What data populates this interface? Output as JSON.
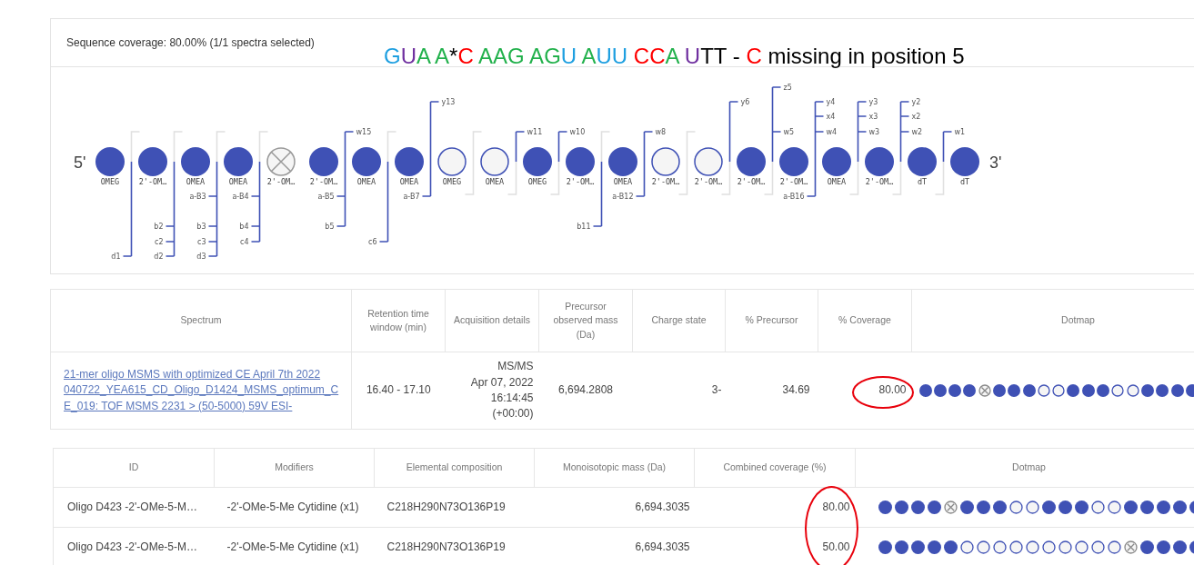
{
  "sequence_panel": {
    "title": "Sequence coverage: 80.00% (1/1 spectra selected)",
    "annotation": [
      {
        "text": "G",
        "color": "#1e9fe0"
      },
      {
        "text": "U",
        "color": "#7030a0"
      },
      {
        "text": "A A",
        "color": "#22b14c"
      },
      {
        "text": "*",
        "color": "#000000"
      },
      {
        "text": "C",
        "color": "#ff0000"
      },
      {
        "text": " AAG AG",
        "color": "#22b14c"
      },
      {
        "text": "U",
        "color": "#1e9fe0"
      },
      {
        "text": " A",
        "color": "#22b14c"
      },
      {
        "text": "UU",
        "color": "#1e9fe0"
      },
      {
        "text": " CC",
        "color": "#ff0000"
      },
      {
        "text": "A",
        "color": "#22b14c"
      },
      {
        "text": " U",
        "color": "#7030a0"
      },
      {
        "text": "TT - ",
        "color": "#000000"
      },
      {
        "text": "C",
        "color": "#ff0000"
      },
      {
        "text": " missing in position 5",
        "color": "#000000"
      }
    ],
    "five_prime": "5'",
    "three_prime": "3'",
    "nucleotides": [
      {
        "label": "OMEG",
        "kind": "filled"
      },
      {
        "label": "2'-OM…",
        "kind": "filled"
      },
      {
        "label": "OMEA",
        "kind": "filled"
      },
      {
        "label": "OMEA",
        "kind": "filled"
      },
      {
        "label": "2'-OM…",
        "kind": "missing"
      },
      {
        "label": "2'-OM…",
        "kind": "filled"
      },
      {
        "label": "OMEA",
        "kind": "filled"
      },
      {
        "label": "OMEA",
        "kind": "filled"
      },
      {
        "label": "OMEG",
        "kind": "empty"
      },
      {
        "label": "OMEA",
        "kind": "empty"
      },
      {
        "label": "OMEG",
        "kind": "filled"
      },
      {
        "label": "2'-OM…",
        "kind": "filled"
      },
      {
        "label": "OMEA",
        "kind": "filled"
      },
      {
        "label": "2'-OM…",
        "kind": "empty"
      },
      {
        "label": "2'-OM…",
        "kind": "empty"
      },
      {
        "label": "2'-OM…",
        "kind": "filled"
      },
      {
        "label": "2'-OM…",
        "kind": "filled"
      },
      {
        "label": "OMEA",
        "kind": "filled"
      },
      {
        "label": "2'-OM…",
        "kind": "filled"
      },
      {
        "label": "dT",
        "kind": "filled"
      },
      {
        "label": "dT",
        "kind": "filled"
      }
    ],
    "gaps": [
      {
        "kind": "fragments",
        "below": {
          "d": "d1"
        }
      },
      {
        "kind": "fragments",
        "below": {
          "b": "b2",
          "c": "c2",
          "d": "d2"
        }
      },
      {
        "kind": "fragments",
        "below": {
          "a_b": "a-B3",
          "b": "b3",
          "c": "c3",
          "d": "d3"
        }
      },
      {
        "kind": "fragments",
        "below": {
          "a_b": "a-B4",
          "b": "b4",
          "c": "c4"
        }
      },
      {
        "kind": "blank"
      },
      {
        "kind": "fragments",
        "above": {
          "w": "w15"
        },
        "below": {
          "a_b": "a-B5",
          "b": "b5"
        }
      },
      {
        "kind": "fragments",
        "below": {
          "c": "c6"
        }
      },
      {
        "kind": "fragments",
        "above": {
          "y": "y13"
        },
        "below": {
          "a_b": "a-B7"
        }
      },
      {
        "kind": "fragments"
      },
      {
        "kind": "fragments",
        "above": {
          "w": "w11"
        }
      },
      {
        "kind": "fragments",
        "above": {
          "w": "w10"
        }
      },
      {
        "kind": "fragments",
        "below": {
          "b": "b11"
        }
      },
      {
        "kind": "fragments",
        "above": {
          "w": "w8"
        },
        "below": {
          "a_b": "a-B12"
        }
      },
      {
        "kind": "fragments"
      },
      {
        "kind": "fragments",
        "above": {
          "y": "y6"
        }
      },
      {
        "kind": "fragments",
        "above": {
          "z": "z5",
          "w": "w5"
        }
      },
      {
        "kind": "fragments",
        "above": {
          "y": "y4",
          "x": "x4",
          "w": "w4"
        },
        "below": {
          "a_b": "a-B16"
        }
      },
      {
        "kind": "fragments",
        "above": {
          "y": "y3",
          "x": "x3",
          "w": "w3"
        }
      },
      {
        "kind": "fragments",
        "above": {
          "y": "y2",
          "x": "x2",
          "w": "w2"
        }
      },
      {
        "kind": "fragments",
        "above": {
          "w": "w1"
        }
      }
    ]
  },
  "spectra_table": {
    "columns": [
      "Spectrum",
      "Retention time window (min)",
      "Acquisition details",
      "Precursor observed mass (Da)",
      "Charge state",
      "% Precursor",
      "% Coverage",
      "Dotmap"
    ],
    "rows": [
      {
        "spectrum": "21-mer oligo MSMS with optimized CE April 7th 2022 040722_YEA615_CD_Oligo_D1424_MSMS_optimum_CE_019: TOF MSMS 2231 > (50-5000) 59V ESI-",
        "retention": "16.40 - 17.10",
        "acquisition": [
          "MS/MS",
          "Apr 07, 2022",
          "16:14:45",
          "(+00:00)"
        ],
        "precursor_mass": "6,694.2808",
        "charge": "3-",
        "precursor_pct": "34.69",
        "coverage": "80.00",
        "coverage_circled": true,
        "dots": [
          {
            "kind": "filled"
          },
          {
            "kind": "filled"
          },
          {
            "kind": "filled"
          },
          {
            "kind": "filled"
          },
          {
            "kind": "missing"
          },
          {
            "kind": "filled"
          },
          {
            "kind": "filled"
          },
          {
            "kind": "filled"
          },
          {
            "kind": "empty"
          },
          {
            "kind": "empty"
          },
          {
            "kind": "filled"
          },
          {
            "kind": "filled"
          },
          {
            "kind": "filled"
          },
          {
            "kind": "empty"
          },
          {
            "kind": "empty"
          },
          {
            "kind": "filled"
          },
          {
            "kind": "filled"
          },
          {
            "kind": "filled"
          },
          {
            "kind": "filled"
          }
        ]
      }
    ]
  },
  "oligo_table": {
    "columns": [
      "ID",
      "Modifiers",
      "Elemental composition",
      "Monoisotopic mass (Da)",
      "Combined coverage (%)",
      "Dotmap"
    ],
    "coverage_circled": true,
    "rows": [
      {
        "id": "Oligo D423 -2'-OMe-5-M…",
        "modifiers": "-2'-OMe-5-Me Cytidine (x1)",
        "composition": "C218H290N73O136P19",
        "mass": "6,694.3035",
        "coverage": "80.00",
        "dots": [
          {
            "kind": "filled"
          },
          {
            "kind": "filled"
          },
          {
            "kind": "filled"
          },
          {
            "kind": "filled"
          },
          {
            "kind": "missing"
          },
          {
            "kind": "filled"
          },
          {
            "kind": "filled"
          },
          {
            "kind": "filled"
          },
          {
            "kind": "empty"
          },
          {
            "kind": "empty"
          },
          {
            "kind": "filled"
          },
          {
            "kind": "filled"
          },
          {
            "kind": "filled"
          },
          {
            "kind": "empty"
          },
          {
            "kind": "empty"
          },
          {
            "kind": "filled"
          },
          {
            "kind": "filled"
          },
          {
            "kind": "filled"
          },
          {
            "kind": "filled"
          },
          {
            "kind": "filled"
          }
        ]
      },
      {
        "id": "Oligo D423 -2'-OMe-5-M…",
        "modifiers": "-2'-OMe-5-Me Cytidine (x1)",
        "composition": "C218H290N73O136P19",
        "mass": "6,694.3035",
        "coverage": "50.00",
        "dots": [
          {
            "kind": "filled"
          },
          {
            "kind": "filled"
          },
          {
            "kind": "filled"
          },
          {
            "kind": "filled"
          },
          {
            "kind": "filled"
          },
          {
            "kind": "empty"
          },
          {
            "kind": "empty"
          },
          {
            "kind": "empty"
          },
          {
            "kind": "empty"
          },
          {
            "kind": "empty"
          },
          {
            "kind": "empty"
          },
          {
            "kind": "empty"
          },
          {
            "kind": "empty"
          },
          {
            "kind": "empty"
          },
          {
            "kind": "empty"
          },
          {
            "kind": "missing"
          },
          {
            "kind": "filled"
          },
          {
            "kind": "filled"
          },
          {
            "kind": "filled"
          },
          {
            "kind": "filled"
          }
        ]
      }
    ]
  }
}
